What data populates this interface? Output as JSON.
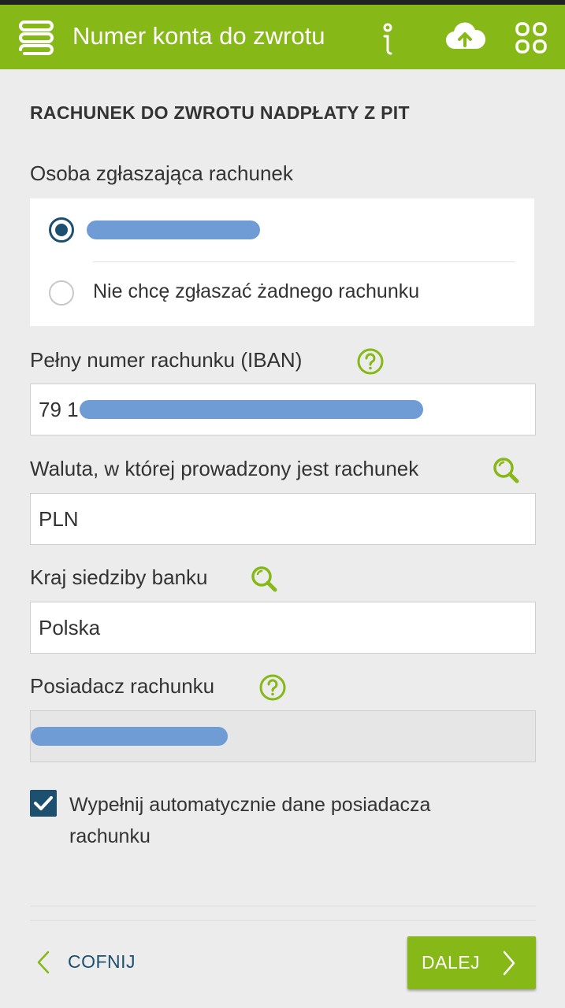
{
  "app_bar": {
    "title": "Numer konta do zwrotu",
    "icons": [
      "menu-icon",
      "info-icon",
      "cloud-upload-icon",
      "apps-grid-icon"
    ],
    "color": "#86b817"
  },
  "form": {
    "section_title": "RACHUNEK DO ZWROTU NADPŁATY Z PIT",
    "account_owner_label": "Osoba zgłaszająca rachunek",
    "radio_options": [
      {
        "label": "",
        "selected": true,
        "redacted": true
      },
      {
        "label": "Nie chcę zgłaszać żadnego rachunku",
        "selected": false
      }
    ],
    "iban_label": "Pełny numer rachunku (IBAN)",
    "iban_value": "79 1",
    "currency_label": "Waluta, w której prowadzony jest rachunek",
    "currency_value": "PLN",
    "bank_country_label": "Kraj siedziby banku",
    "bank_country_value": "Polska",
    "holder_label": "Posiadacz rachunku",
    "holder_value": "",
    "autofill_label": "Wypełnij automatycznie dane posiadacza rachunku",
    "autofill_checked": true
  },
  "footer": {
    "back_label": "COFNIJ",
    "next_label": "DALEJ"
  },
  "colors": {
    "accent": "#86b817",
    "primary_dark": "#1d4f6e",
    "redaction": "#6f9cd4"
  }
}
